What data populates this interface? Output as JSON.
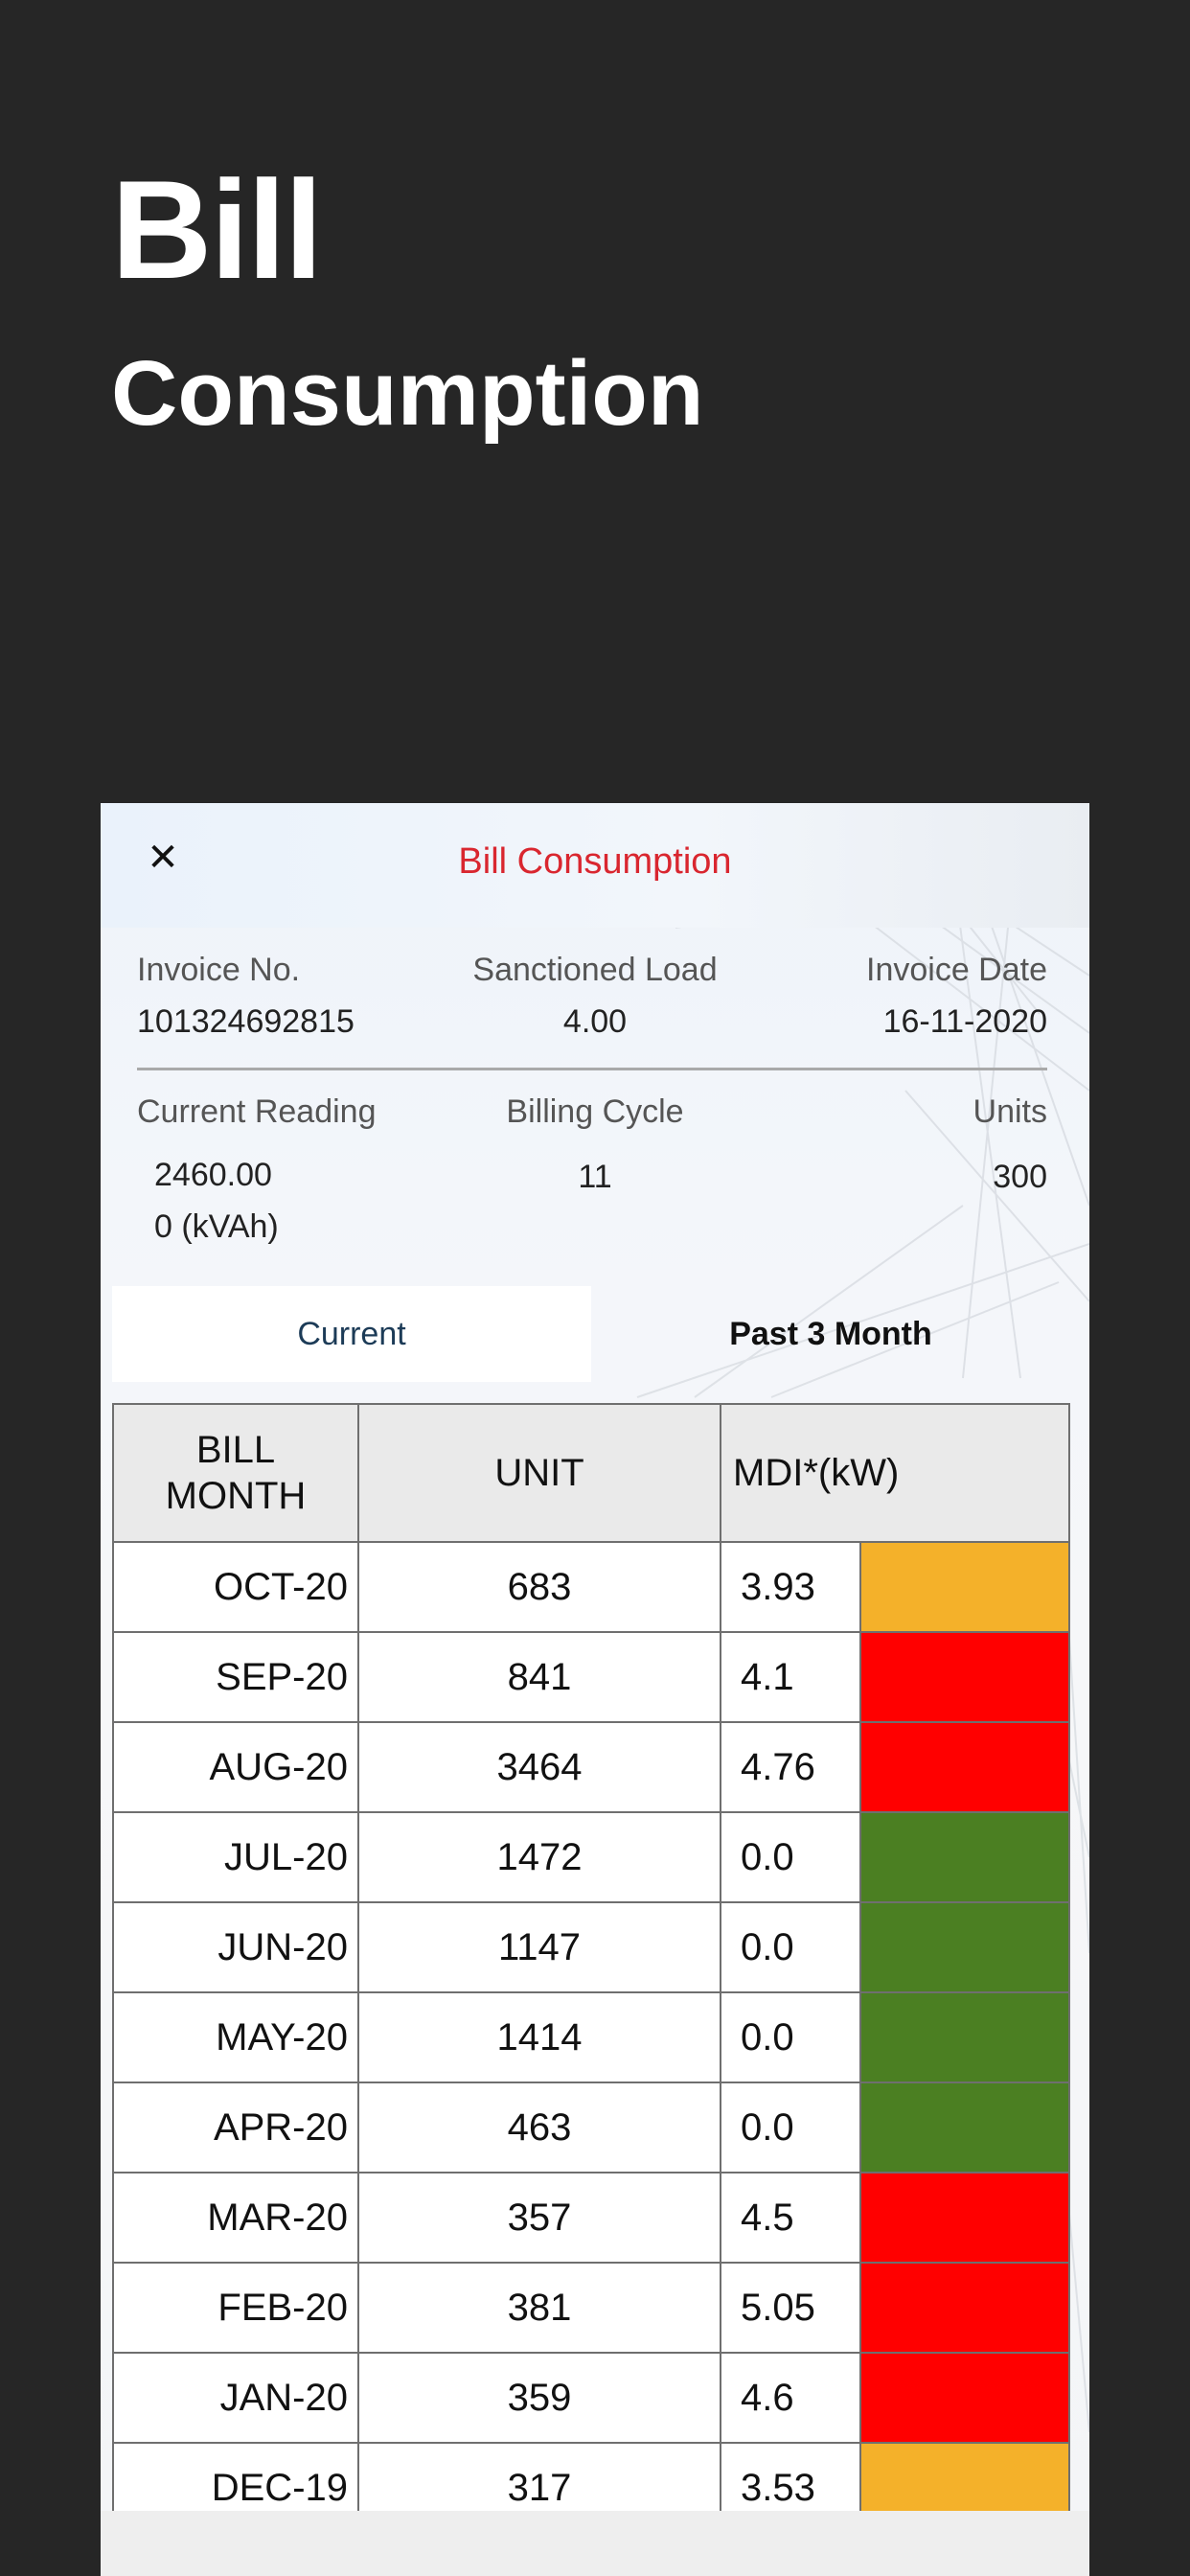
{
  "hero": {
    "title": "Bill",
    "subtitle": "Consumption"
  },
  "screen": {
    "title": "Bill Consumption",
    "close_icon": "close-icon"
  },
  "info": {
    "invoice_no_label": "Invoice No.",
    "invoice_no_value": "101324692815",
    "sanctioned_load_label": "Sanctioned Load",
    "sanctioned_load_value": "4.00",
    "invoice_date_label": "Invoice Date",
    "invoice_date_value": "16-11-2020",
    "current_reading_label": "Current Reading",
    "current_reading_value": "2460.00",
    "current_reading_kvah": "0 (kVAh)",
    "billing_cycle_label": "Billing Cycle",
    "billing_cycle_value": "11",
    "units_label": "Units",
    "units_value": "300"
  },
  "tabs": [
    {
      "label": "Current",
      "active": true
    },
    {
      "label": "Past 3 Month",
      "active": false
    }
  ],
  "table": {
    "headers": [
      "BILL MONTH",
      "UNIT",
      "MDI*(kW)"
    ],
    "colors": {
      "orange": "#F4B12A",
      "red": "#FF0000",
      "green": "#4B7F22"
    },
    "rows": [
      {
        "month": "OCT-20",
        "unit": "683",
        "mdi": "3.93",
        "status": "orange"
      },
      {
        "month": "SEP-20",
        "unit": "841",
        "mdi": "4.1",
        "status": "red"
      },
      {
        "month": "AUG-20",
        "unit": "3464",
        "mdi": "4.76",
        "status": "red"
      },
      {
        "month": "JUL-20",
        "unit": "1472",
        "mdi": "0.0",
        "status": "green"
      },
      {
        "month": "JUN-20",
        "unit": "1147",
        "mdi": "0.0",
        "status": "green"
      },
      {
        "month": "MAY-20",
        "unit": "1414",
        "mdi": "0.0",
        "status": "green"
      },
      {
        "month": "APR-20",
        "unit": "463",
        "mdi": "0.0",
        "status": "green"
      },
      {
        "month": "MAR-20",
        "unit": "357",
        "mdi": "4.5",
        "status": "red"
      },
      {
        "month": "FEB-20",
        "unit": "381",
        "mdi": "5.05",
        "status": "red"
      },
      {
        "month": "JAN-20",
        "unit": "359",
        "mdi": "4.6",
        "status": "red"
      },
      {
        "month": "DEC-19",
        "unit": "317",
        "mdi": "3.53",
        "status": "orange"
      }
    ]
  }
}
